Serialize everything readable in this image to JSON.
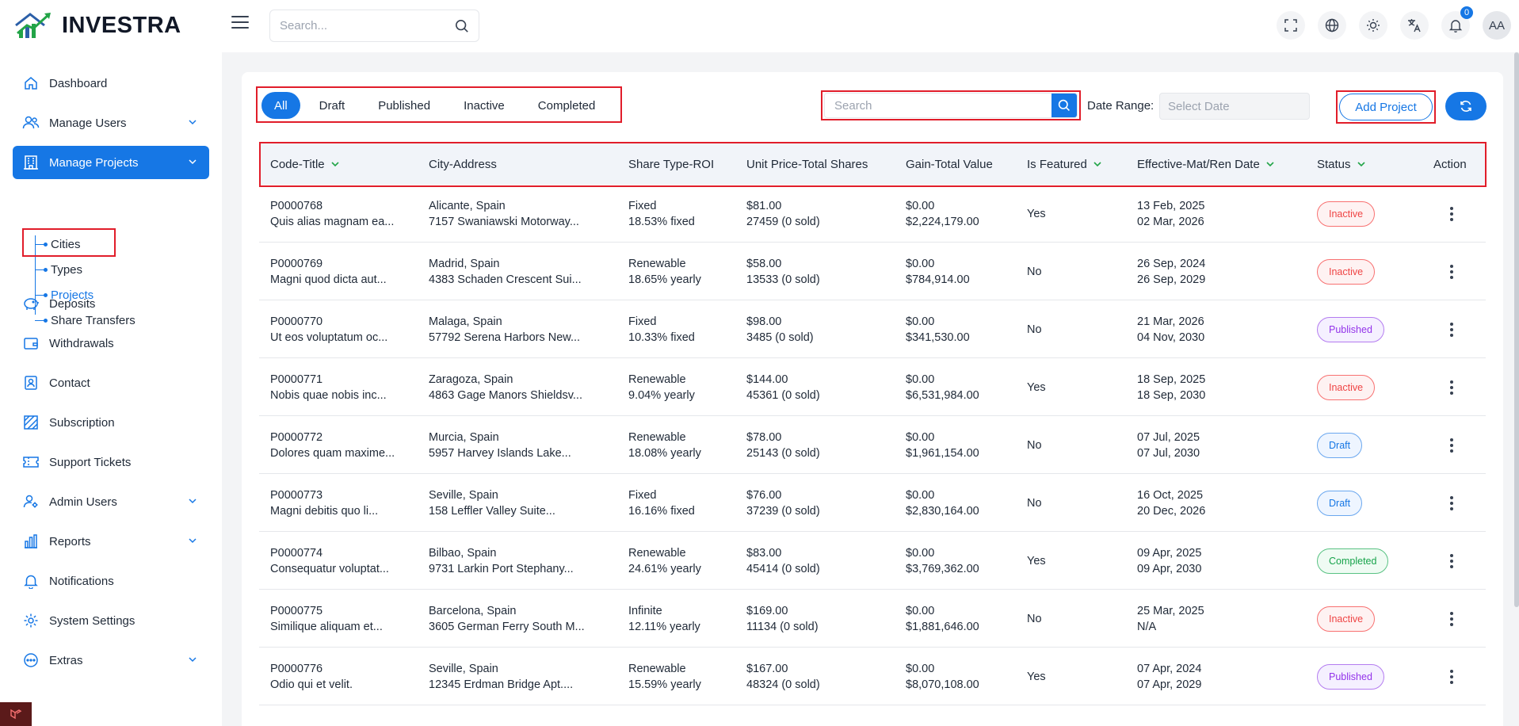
{
  "app": {
    "brand": "INVESTRA"
  },
  "header": {
    "search_placeholder": "Search...",
    "notification_count": "0",
    "avatar_initials": "AA",
    "icons": [
      "fullscreen-icon",
      "globe-icon",
      "sun-icon",
      "translate-icon",
      "bell-icon"
    ]
  },
  "sidebar": {
    "items": [
      {
        "label": "Dashboard",
        "icon": "home-icon"
      },
      {
        "label": "Manage Users",
        "icon": "users-icon"
      },
      {
        "label": "Manage Projects",
        "icon": "building-icon"
      },
      {
        "label": "Deposits",
        "icon": "piggy-bank-icon"
      },
      {
        "label": "Withdrawals",
        "icon": "wallet-icon"
      },
      {
        "label": "Contact",
        "icon": "contact-icon"
      },
      {
        "label": "Subscription",
        "icon": "subscription-icon"
      },
      {
        "label": "Support Tickets",
        "icon": "ticket-icon"
      },
      {
        "label": "Admin Users",
        "icon": "admin-user-icon"
      },
      {
        "label": "Reports",
        "icon": "chart-icon"
      },
      {
        "label": "Notifications",
        "icon": "bell-icon"
      },
      {
        "label": "System Settings",
        "icon": "gear-icon"
      },
      {
        "label": "Extras",
        "icon": "more-icon"
      }
    ],
    "sub_items": [
      {
        "label": "Cities"
      },
      {
        "label": "Types"
      },
      {
        "label": "Projects"
      },
      {
        "label": "Share Transfers"
      }
    ]
  },
  "toolbar": {
    "tabs": [
      "All",
      "Draft",
      "Published",
      "Inactive",
      "Completed"
    ],
    "search_placeholder": "Search",
    "date_range_label": "Date Range:",
    "date_placeholder": "Select Date",
    "add_label": "Add Project"
  },
  "table": {
    "columns": [
      "Code-Title",
      "City-Address",
      "Share Type-ROI",
      "Unit Price-Total Shares",
      "Gain-Total Value",
      "Is Featured",
      "Effective-Mat/Ren Date",
      "Status",
      "Action"
    ],
    "rows": [
      {
        "code": "P0000768",
        "title": "Quis alias magnam ea...",
        "city": "Alicante, Spain",
        "address": "7157 Swaniawski Motorway...",
        "share_type": "Fixed",
        "roi": "18.53% fixed",
        "unit_price": "$81.00",
        "shares": "27459 (0 sold)",
        "gain": "$0.00",
        "total": "$2,224,179.00",
        "featured": "Yes",
        "effective": "13 Feb, 2025",
        "maturity": "02 Mar, 2026",
        "status": "Inactive"
      },
      {
        "code": "P0000769",
        "title": "Magni quod dicta aut...",
        "city": "Madrid, Spain",
        "address": "4383 Schaden Crescent Sui...",
        "share_type": "Renewable",
        "roi": "18.65% yearly",
        "unit_price": "$58.00",
        "shares": "13533 (0 sold)",
        "gain": "$0.00",
        "total": "$784,914.00",
        "featured": "No",
        "effective": "26 Sep, 2024",
        "maturity": "26 Sep, 2029",
        "status": "Inactive"
      },
      {
        "code": "P0000770",
        "title": "Ut eos voluptatum oc...",
        "city": "Malaga, Spain",
        "address": "57792 Serena Harbors New...",
        "share_type": "Fixed",
        "roi": "10.33% fixed",
        "unit_price": "$98.00",
        "shares": "3485 (0 sold)",
        "gain": "$0.00",
        "total": "$341,530.00",
        "featured": "No",
        "effective": "21 Mar, 2026",
        "maturity": "04 Nov, 2030",
        "status": "Published"
      },
      {
        "code": "P0000771",
        "title": "Nobis quae nobis inc...",
        "city": "Zaragoza, Spain",
        "address": "4863 Gage Manors Shieldsv...",
        "share_type": "Renewable",
        "roi": "9.04% yearly",
        "unit_price": "$144.00",
        "shares": "45361 (0 sold)",
        "gain": "$0.00",
        "total": "$6,531,984.00",
        "featured": "Yes",
        "effective": "18 Sep, 2025",
        "maturity": "18 Sep, 2030",
        "status": "Inactive"
      },
      {
        "code": "P0000772",
        "title": "Dolores quam maxime...",
        "city": "Murcia, Spain",
        "address": "5957 Harvey Islands Lake...",
        "share_type": "Renewable",
        "roi": "18.08% yearly",
        "unit_price": "$78.00",
        "shares": "25143 (0 sold)",
        "gain": "$0.00",
        "total": "$1,961,154.00",
        "featured": "No",
        "effective": "07 Jul, 2025",
        "maturity": "07 Jul, 2030",
        "status": "Draft"
      },
      {
        "code": "P0000773",
        "title": "Magni debitis quo li...",
        "city": "Seville, Spain",
        "address": "158 Leffler Valley Suite...",
        "share_type": "Fixed",
        "roi": "16.16% fixed",
        "unit_price": "$76.00",
        "shares": "37239 (0 sold)",
        "gain": "$0.00",
        "total": "$2,830,164.00",
        "featured": "No",
        "effective": "16 Oct, 2025",
        "maturity": "20 Dec, 2026",
        "status": "Draft"
      },
      {
        "code": "P0000774",
        "title": "Consequatur voluptat...",
        "city": "Bilbao, Spain",
        "address": "9731 Larkin Port Stephany...",
        "share_type": "Renewable",
        "roi": "24.61% yearly",
        "unit_price": "$83.00",
        "shares": "45414 (0 sold)",
        "gain": "$0.00",
        "total": "$3,769,362.00",
        "featured": "Yes",
        "effective": "09 Apr, 2025",
        "maturity": "09 Apr, 2030",
        "status": "Completed"
      },
      {
        "code": "P0000775",
        "title": "Similique aliquam et...",
        "city": "Barcelona, Spain",
        "address": "3605 German Ferry South M...",
        "share_type": "Infinite",
        "roi": "12.11% yearly",
        "unit_price": "$169.00",
        "shares": "11134 (0 sold)",
        "gain": "$0.00",
        "total": "$1,881,646.00",
        "featured": "No",
        "effective": "25 Mar, 2025",
        "maturity": "N/A",
        "status": "Inactive"
      },
      {
        "code": "P0000776",
        "title": "Odio qui et velit.",
        "city": "Seville, Spain",
        "address": "12345 Erdman Bridge Apt....",
        "share_type": "Renewable",
        "roi": "15.59% yearly",
        "unit_price": "$167.00",
        "shares": "48324 (0 sold)",
        "gain": "$0.00",
        "total": "$8,070,108.00",
        "featured": "Yes",
        "effective": "07 Apr, 2024",
        "maturity": "07 Apr, 2029",
        "status": "Published"
      }
    ]
  },
  "colors": {
    "accent": "#1677e5",
    "highlight": "#e11d2a"
  }
}
